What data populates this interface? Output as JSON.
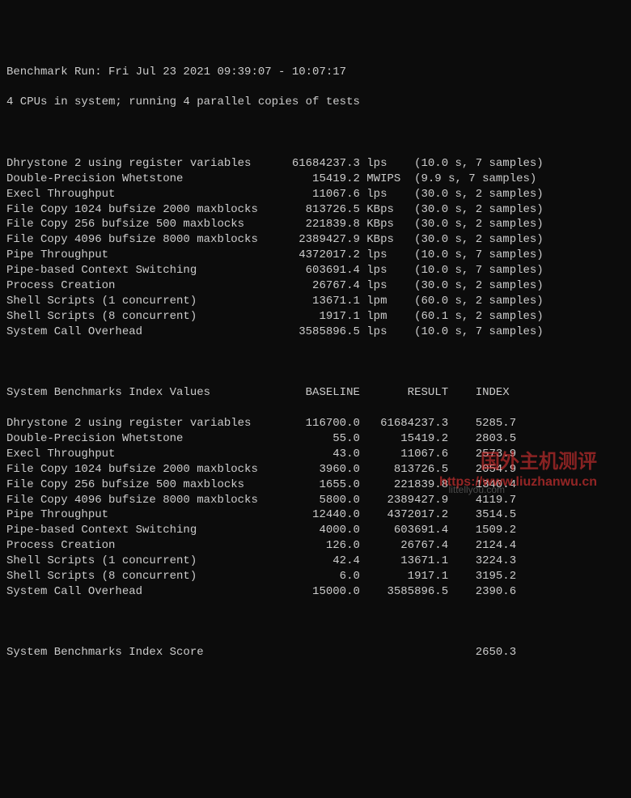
{
  "header": {
    "line1": "Benchmark Run: Fri Jul 23 2021 09:39:07 - 10:07:17",
    "line2": "4 CPUs in system; running 4 parallel copies of tests"
  },
  "results": [
    {
      "name": "Dhrystone 2 using register variables",
      "value": "61684237.3",
      "unit": "lps",
      "timing": "(10.0 s, 7 samples)"
    },
    {
      "name": "Double-Precision Whetstone",
      "value": "15419.2",
      "unit": "MWIPS",
      "timing": "(9.9 s, 7 samples)"
    },
    {
      "name": "Execl Throughput",
      "value": "11067.6",
      "unit": "lps",
      "timing": "(30.0 s, 2 samples)"
    },
    {
      "name": "File Copy 1024 bufsize 2000 maxblocks",
      "value": "813726.5",
      "unit": "KBps",
      "timing": "(30.0 s, 2 samples)"
    },
    {
      "name": "File Copy 256 bufsize 500 maxblocks",
      "value": "221839.8",
      "unit": "KBps",
      "timing": "(30.0 s, 2 samples)"
    },
    {
      "name": "File Copy 4096 bufsize 8000 maxblocks",
      "value": "2389427.9",
      "unit": "KBps",
      "timing": "(30.0 s, 2 samples)"
    },
    {
      "name": "Pipe Throughput",
      "value": "4372017.2",
      "unit": "lps",
      "timing": "(10.0 s, 7 samples)"
    },
    {
      "name": "Pipe-based Context Switching",
      "value": "603691.4",
      "unit": "lps",
      "timing": "(10.0 s, 7 samples)"
    },
    {
      "name": "Process Creation",
      "value": "26767.4",
      "unit": "lps",
      "timing": "(30.0 s, 2 samples)"
    },
    {
      "name": "Shell Scripts (1 concurrent)",
      "value": "13671.1",
      "unit": "lpm",
      "timing": "(60.0 s, 2 samples)"
    },
    {
      "name": "Shell Scripts (8 concurrent)",
      "value": "1917.1",
      "unit": "lpm",
      "timing": "(60.1 s, 2 samples)"
    },
    {
      "name": "System Call Overhead",
      "value": "3585896.5",
      "unit": "lps",
      "timing": "(10.0 s, 7 samples)"
    }
  ],
  "index_header": {
    "title": "System Benchmarks Index Values",
    "col1": "BASELINE",
    "col2": "RESULT",
    "col3": "INDEX"
  },
  "index_rows": [
    {
      "name": "Dhrystone 2 using register variables",
      "baseline": "116700.0",
      "result": "61684237.3",
      "index": "5285.7"
    },
    {
      "name": "Double-Precision Whetstone",
      "baseline": "55.0",
      "result": "15419.2",
      "index": "2803.5"
    },
    {
      "name": "Execl Throughput",
      "baseline": "43.0",
      "result": "11067.6",
      "index": "2573.9"
    },
    {
      "name": "File Copy 1024 bufsize 2000 maxblocks",
      "baseline": "3960.0",
      "result": "813726.5",
      "index": "2054.9"
    },
    {
      "name": "File Copy 256 bufsize 500 maxblocks",
      "baseline": "1655.0",
      "result": "221839.8",
      "index": "1340.4"
    },
    {
      "name": "File Copy 4096 bufsize 8000 maxblocks",
      "baseline": "5800.0",
      "result": "2389427.9",
      "index": "4119.7"
    },
    {
      "name": "Pipe Throughput",
      "baseline": "12440.0",
      "result": "4372017.2",
      "index": "3514.5"
    },
    {
      "name": "Pipe-based Context Switching",
      "baseline": "4000.0",
      "result": "603691.4",
      "index": "1509.2"
    },
    {
      "name": "Process Creation",
      "baseline": "126.0",
      "result": "26767.4",
      "index": "2124.4"
    },
    {
      "name": "Shell Scripts (1 concurrent)",
      "baseline": "42.4",
      "result": "13671.1",
      "index": "3224.3"
    },
    {
      "name": "Shell Scripts (8 concurrent)",
      "baseline": "6.0",
      "result": "1917.1",
      "index": "3195.2"
    },
    {
      "name": "System Call Overhead",
      "baseline": "15000.0",
      "result": "3585896.5",
      "index": "2390.6"
    }
  ],
  "score": {
    "label": "System Benchmarks Index Score",
    "value": "2650.3"
  },
  "watermark": {
    "text": "国外主机测评",
    "url": "https://www.liuzhanwu.cn",
    "sub": "littellyou.com"
  }
}
